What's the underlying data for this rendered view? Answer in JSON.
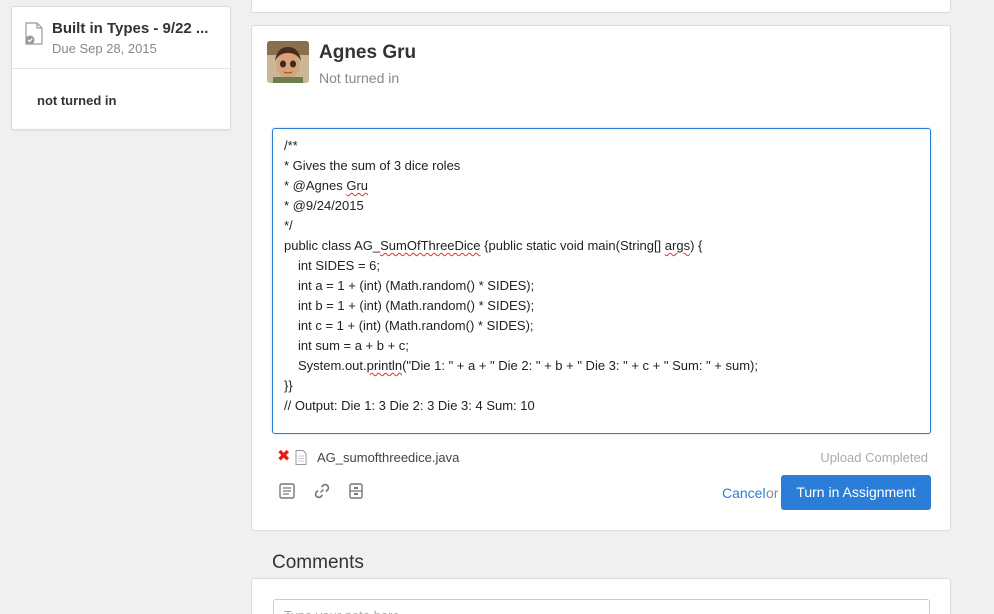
{
  "assignment": {
    "title": "Built in Types - 9/22 ...",
    "due": "Due Sep 28, 2015",
    "status": "not turned in"
  },
  "submission": {
    "student_name": "Agnes Gru",
    "student_status": "Not turned in",
    "code_lines": [
      "/**",
      "* Gives the sum of 3 dice roles",
      "* @Agnes Gru",
      "* @9/24/2015",
      "*/",
      "public class AG_SumOfThreeDice {public static void main(String[] args) {",
      "int SIDES = 6;",
      "int a = 1 + (int) (Math.random() * SIDES);",
      "int b = 1 + (int) (Math.random() * SIDES);",
      "int c = 1 + (int) (Math.random() * SIDES);",
      "int sum = a + b + c;",
      "System.out.println(\"Die 1: \" + a + \" Die 2: \" + b + \" Die 3: \" + c + \" Sum: \" + sum);",
      "}}",
      "// Output: Die 1: 3 Die 2: 3 Die 3: 4 Sum: 10"
    ],
    "attachment_name": "AG_sumofthreedice.java",
    "upload_status": "Upload Completed",
    "cancel_label": "Cancel",
    "or_label": "or",
    "submit_label": "Turn in Assignment"
  },
  "comments": {
    "title": "Comments",
    "placeholder": "Type your note here"
  },
  "colors": {
    "accent": "#2a7ed8",
    "remove": "#e0221c"
  },
  "icons": [
    "document-icon",
    "remove-icon",
    "file-icon",
    "text-icon",
    "link-icon",
    "drive-icon"
  ]
}
